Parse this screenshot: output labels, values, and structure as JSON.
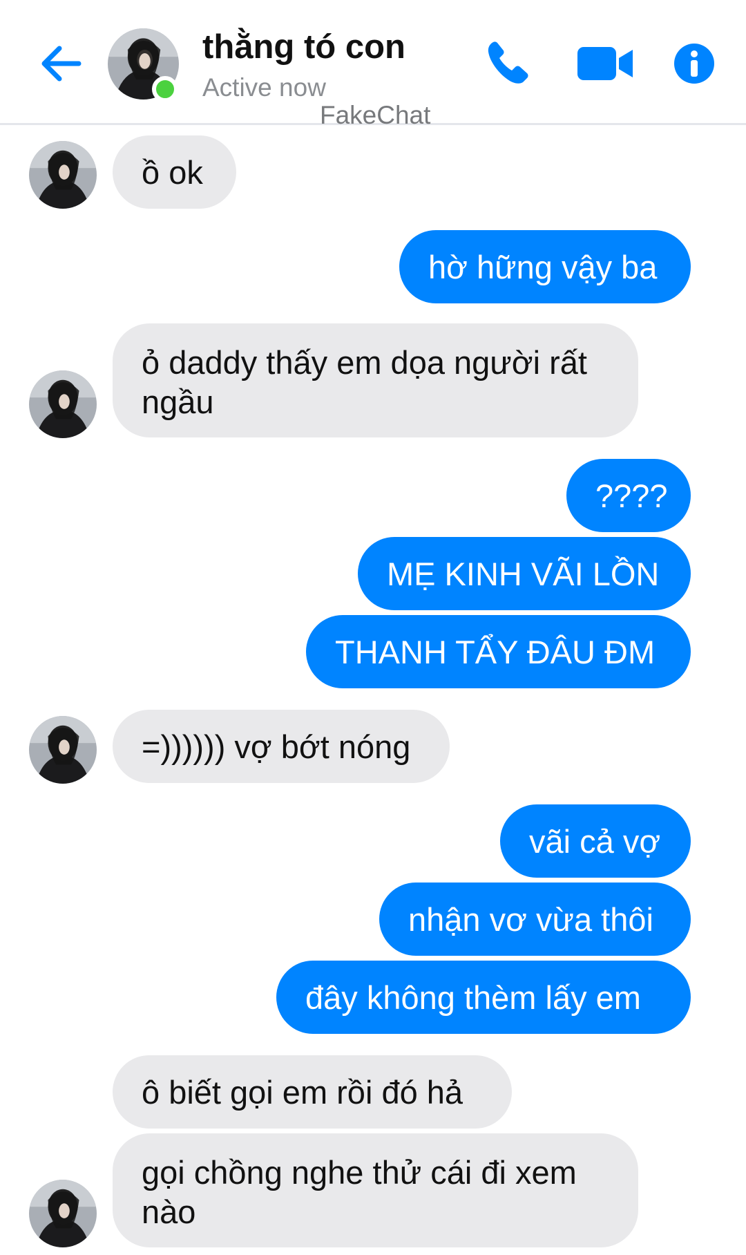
{
  "header": {
    "contact_name": "thằng tó con",
    "status": "Active now",
    "watermark": "FakeChat",
    "back_icon": "arrow-left-icon",
    "call_icon": "phone-icon",
    "video_icon": "video-camera-icon",
    "info_icon": "info-icon",
    "accent_color": "#0084ff",
    "active_color": "#4bd13f"
  },
  "messages": [
    {
      "from": "contact",
      "text": "ồ ok"
    },
    {
      "from": "me",
      "text": "hờ hững vậy ba"
    },
    {
      "from": "contact",
      "text": "ỏ daddy thấy em dọa người rất ngầu"
    },
    {
      "from": "me",
      "text": "????"
    },
    {
      "from": "me",
      "text": "MẸ KINH VÃI LỒN"
    },
    {
      "from": "me",
      "text": "THANH TẨY ĐÂU ĐM"
    },
    {
      "from": "contact",
      "text": "=)))))) vợ bớt nóng"
    },
    {
      "from": "me",
      "text": "vãi cả vợ"
    },
    {
      "from": "me",
      "text": "nhận vơ vừa thôi"
    },
    {
      "from": "me",
      "text": "đây không thèm lấy em"
    },
    {
      "from": "contact",
      "text": "ô biết gọi em rồi đó hả"
    },
    {
      "from": "contact",
      "text": "gọi chồng nghe thử cái đi xem nào"
    }
  ],
  "colors": {
    "incoming_bubble": "#e9e9eb",
    "outgoing_bubble": "#0084ff"
  }
}
